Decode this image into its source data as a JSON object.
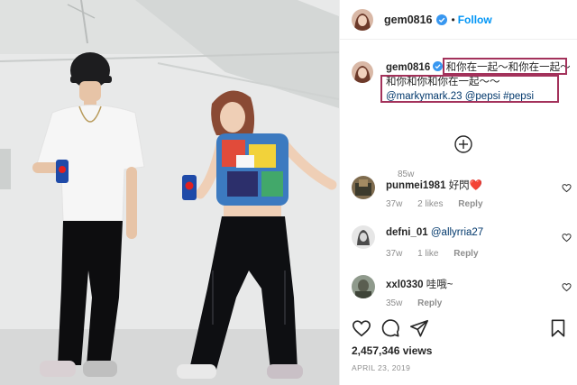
{
  "post": {
    "username": "gem0816",
    "follow_label": "Follow",
    "dot": "•",
    "caption_line1": "和你在一起～和你在一起～",
    "caption_line2": "和你和你和你在一起～～",
    "caption_mention1": "@markymark.23",
    "caption_mention2": "@pepsi",
    "caption_hashtag": "#pepsi",
    "time_ago": "85w",
    "views": "2,457,346 views",
    "date": "APRIL 23, 2019"
  },
  "comments": [
    {
      "username": "punmei1981",
      "text": "好閃",
      "emoji": "❤️",
      "time": "37w",
      "likes": "2 likes",
      "reply": "Reply"
    },
    {
      "username": "defni_01",
      "mention": "@allyrria27",
      "time": "37w",
      "likes": "1 like",
      "reply": "Reply"
    },
    {
      "username": "xxl0330",
      "text": "哇哦~",
      "time": "35w",
      "reply": "Reply"
    }
  ],
  "colors": {
    "accent_blue": "#0095f6",
    "link_blue": "#00376b",
    "highlight_box": "#a3325b",
    "heart_red": "#ed4956"
  },
  "icons": [
    "verified-badge-icon",
    "add-comment-icon",
    "comment-heart-icon",
    "like-icon",
    "comment-icon",
    "share-icon",
    "save-icon"
  ]
}
